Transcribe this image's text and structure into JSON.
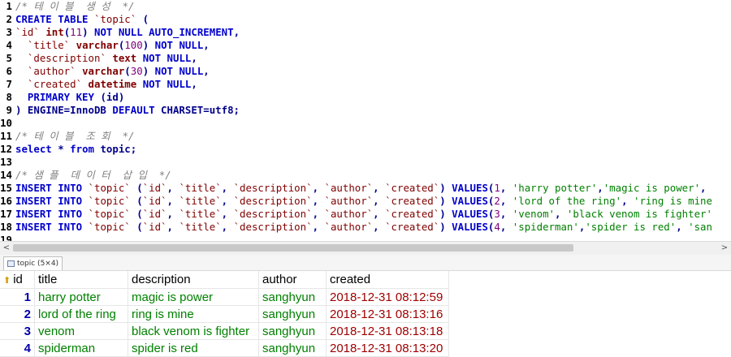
{
  "editor": {
    "lines": [
      {
        "n": "1",
        "parts": [
          [
            "cmt",
            "/* 테 이 블  생 성  */"
          ]
        ]
      },
      {
        "n": "2",
        "parts": [
          [
            "kw",
            "CREATE TABLE "
          ],
          [
            "bt",
            "`topic`"
          ],
          [
            "code",
            " ("
          ]
        ]
      },
      {
        "n": "3",
        "parts": [
          [
            "bt",
            "`id`"
          ],
          [
            "code",
            " "
          ],
          [
            "ty",
            "int"
          ],
          [
            "code",
            "("
          ],
          [
            "num",
            "11"
          ],
          [
            "code",
            ") "
          ],
          [
            "kw",
            "NOT NULL AUTO_INCREMENT"
          ],
          [
            "code",
            ","
          ]
        ]
      },
      {
        "n": "4",
        "parts": [
          [
            "code",
            "  "
          ],
          [
            "bt",
            "`title`"
          ],
          [
            "code",
            " "
          ],
          [
            "ty",
            "varchar"
          ],
          [
            "code",
            "("
          ],
          [
            "num",
            "100"
          ],
          [
            "code",
            ") "
          ],
          [
            "kw",
            "NOT NULL"
          ],
          [
            "code",
            ","
          ]
        ]
      },
      {
        "n": "5",
        "parts": [
          [
            "code",
            "  "
          ],
          [
            "bt",
            "`description`"
          ],
          [
            "code",
            " "
          ],
          [
            "ty",
            "text"
          ],
          [
            "code",
            " "
          ],
          [
            "kw",
            "NOT NULL"
          ],
          [
            "code",
            ","
          ]
        ]
      },
      {
        "n": "6",
        "parts": [
          [
            "code",
            "  "
          ],
          [
            "bt",
            "`author`"
          ],
          [
            "code",
            " "
          ],
          [
            "ty",
            "varchar"
          ],
          [
            "code",
            "("
          ],
          [
            "num",
            "30"
          ],
          [
            "code",
            ") "
          ],
          [
            "kw",
            "NOT NULL"
          ],
          [
            "code",
            ","
          ]
        ]
      },
      {
        "n": "7",
        "parts": [
          [
            "code",
            "  "
          ],
          [
            "bt",
            "`created`"
          ],
          [
            "code",
            " "
          ],
          [
            "ty",
            "datetime"
          ],
          [
            "code",
            " "
          ],
          [
            "kw",
            "NOT NULL"
          ],
          [
            "code",
            ","
          ]
        ]
      },
      {
        "n": "8",
        "parts": [
          [
            "code",
            "  "
          ],
          [
            "kw",
            "PRIMARY KEY"
          ],
          [
            "code",
            " (id)"
          ]
        ]
      },
      {
        "n": "9",
        "parts": [
          [
            "code",
            ") ENGINE=InnoDB "
          ],
          [
            "kw",
            "DEFAULT"
          ],
          [
            "code",
            " CHARSET=utf8;"
          ]
        ]
      },
      {
        "n": "10",
        "parts": []
      },
      {
        "n": "11",
        "parts": [
          [
            "cmt",
            "/* 테 이 블  조 회  */"
          ]
        ]
      },
      {
        "n": "12",
        "parts": [
          [
            "kw",
            "select"
          ],
          [
            "code",
            " * "
          ],
          [
            "kw",
            "from"
          ],
          [
            "code",
            " topic;"
          ]
        ]
      },
      {
        "n": "13",
        "parts": []
      },
      {
        "n": "14",
        "parts": [
          [
            "cmt",
            "/* 샘 플  데 이 터  삽 입  */"
          ]
        ]
      },
      {
        "n": "15",
        "parts": [
          [
            "kw",
            "INSERT INTO "
          ],
          [
            "bt",
            "`topic`"
          ],
          [
            "code",
            " ("
          ],
          [
            "bt",
            "`id`"
          ],
          [
            "code",
            ", "
          ],
          [
            "bt",
            "`title`"
          ],
          [
            "code",
            ", "
          ],
          [
            "bt",
            "`description`"
          ],
          [
            "code",
            ", "
          ],
          [
            "bt",
            "`author`"
          ],
          [
            "code",
            ", "
          ],
          [
            "bt",
            "`created`"
          ],
          [
            "code",
            ") "
          ],
          [
            "kw",
            "VALUES"
          ],
          [
            "code",
            "("
          ],
          [
            "num",
            "1"
          ],
          [
            "code",
            ", "
          ],
          [
            "str",
            "'harry potter'"
          ],
          [
            "code",
            ","
          ],
          [
            "str",
            "'magic is power'"
          ],
          [
            "code",
            ", "
          ]
        ]
      },
      {
        "n": "16",
        "parts": [
          [
            "kw",
            "INSERT INTO "
          ],
          [
            "bt",
            "`topic`"
          ],
          [
            "code",
            " ("
          ],
          [
            "bt",
            "`id`"
          ],
          [
            "code",
            ", "
          ],
          [
            "bt",
            "`title`"
          ],
          [
            "code",
            ", "
          ],
          [
            "bt",
            "`description`"
          ],
          [
            "code",
            ", "
          ],
          [
            "bt",
            "`author`"
          ],
          [
            "code",
            ", "
          ],
          [
            "bt",
            "`created`"
          ],
          [
            "code",
            ") "
          ],
          [
            "kw",
            "VALUES"
          ],
          [
            "code",
            "("
          ],
          [
            "num",
            "2"
          ],
          [
            "code",
            ", "
          ],
          [
            "str",
            "'lord of the ring'"
          ],
          [
            "code",
            ", "
          ],
          [
            "str",
            "'ring is mine"
          ]
        ]
      },
      {
        "n": "17",
        "parts": [
          [
            "kw",
            "INSERT INTO "
          ],
          [
            "bt",
            "`topic`"
          ],
          [
            "code",
            " ("
          ],
          [
            "bt",
            "`id`"
          ],
          [
            "code",
            ", "
          ],
          [
            "bt",
            "`title`"
          ],
          [
            "code",
            ", "
          ],
          [
            "bt",
            "`description`"
          ],
          [
            "code",
            ", "
          ],
          [
            "bt",
            "`author`"
          ],
          [
            "code",
            ", "
          ],
          [
            "bt",
            "`created`"
          ],
          [
            "code",
            ") "
          ],
          [
            "kw",
            "VALUES"
          ],
          [
            "code",
            "("
          ],
          [
            "num",
            "3"
          ],
          [
            "code",
            ", "
          ],
          [
            "str",
            "'venom'"
          ],
          [
            "code",
            ", "
          ],
          [
            "str",
            "'black venom is fighter'"
          ]
        ]
      },
      {
        "n": "18",
        "parts": [
          [
            "kw",
            "INSERT INTO "
          ],
          [
            "bt",
            "`topic`"
          ],
          [
            "code",
            " ("
          ],
          [
            "bt",
            "`id`"
          ],
          [
            "code",
            ", "
          ],
          [
            "bt",
            "`title`"
          ],
          [
            "code",
            ", "
          ],
          [
            "bt",
            "`description`"
          ],
          [
            "code",
            ", "
          ],
          [
            "bt",
            "`author`"
          ],
          [
            "code",
            ", "
          ],
          [
            "bt",
            "`created`"
          ],
          [
            "code",
            ") "
          ],
          [
            "kw",
            "VALUES"
          ],
          [
            "code",
            "("
          ],
          [
            "num",
            "4"
          ],
          [
            "code",
            ", "
          ],
          [
            "str",
            "'spiderman'"
          ],
          [
            "code",
            ","
          ],
          [
            "str",
            "'spider is red'"
          ],
          [
            "code",
            ", "
          ],
          [
            "str",
            "'san"
          ]
        ]
      },
      {
        "n": "19",
        "parts": []
      }
    ]
  },
  "scrollbar": {
    "left_arrow": "<",
    "right_arrow": ">"
  },
  "result_tab": {
    "label": "topic (5×4)"
  },
  "grid": {
    "columns": [
      "id",
      "title",
      "description",
      "author",
      "created"
    ],
    "key_icon": "⬆",
    "rows": [
      [
        "1",
        "harry potter",
        "magic is power",
        "sanghyun",
        "2018-12-31 08:12:59"
      ],
      [
        "2",
        "lord of the ring",
        "ring is mine",
        "sanghyun",
        "2018-12-31 08:13:16"
      ],
      [
        "3",
        "venom",
        "black venom is fighter",
        "sanghyun",
        "2018-12-31 08:13:18"
      ],
      [
        "4",
        "spiderman",
        "spider is red",
        "sanghyun",
        "2018-12-31 08:13:20"
      ]
    ]
  }
}
